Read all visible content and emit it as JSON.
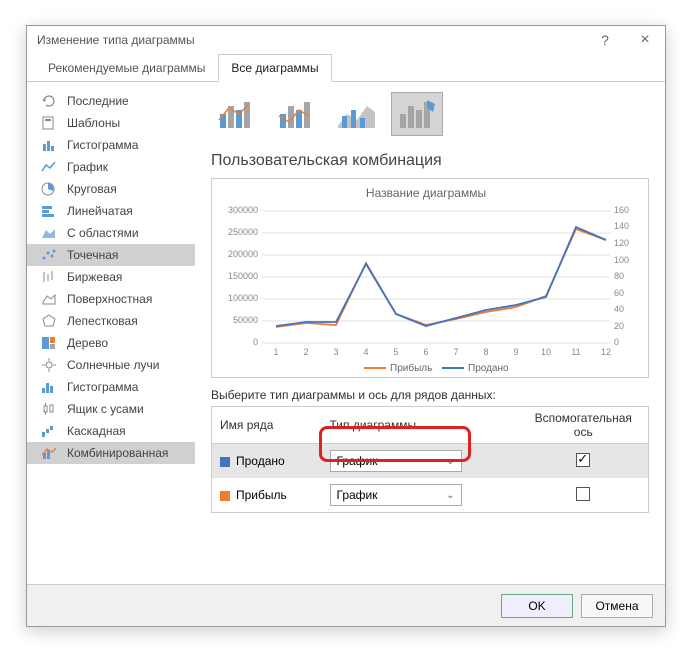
{
  "window": {
    "title": "Изменение типа диаграммы"
  },
  "tabs": {
    "recommended": "Рекомендуемые диаграммы",
    "all": "Все диаграммы"
  },
  "sidebar": {
    "items": [
      {
        "label": "Последние"
      },
      {
        "label": "Шаблоны"
      },
      {
        "label": "Гистограмма"
      },
      {
        "label": "График"
      },
      {
        "label": "Круговая"
      },
      {
        "label": "Линейчатая"
      },
      {
        "label": "С областями"
      },
      {
        "label": "Точечная"
      },
      {
        "label": "Биржевая"
      },
      {
        "label": "Поверхностная"
      },
      {
        "label": "Лепестковая"
      },
      {
        "label": "Дерево"
      },
      {
        "label": "Солнечные лучи"
      },
      {
        "label": "Гистограмма"
      },
      {
        "label": "Ящик с усами"
      },
      {
        "label": "Каскадная"
      },
      {
        "label": "Комбинированная"
      }
    ]
  },
  "section": {
    "title": "Пользовательская комбинация"
  },
  "chart": {
    "title": "Название диаграммы"
  },
  "chart_data": {
    "type": "line",
    "title": "Название диаграммы",
    "x": [
      1,
      2,
      3,
      4,
      5,
      6,
      7,
      8,
      9,
      10,
      11,
      12
    ],
    "series": [
      {
        "name": "Прибыль",
        "axis": "left",
        "color": "#ed7d31",
        "values": [
          35000,
          45000,
          40000,
          180000,
          65000,
          40000,
          55000,
          70000,
          80000,
          105000,
          260000,
          235000
        ]
      },
      {
        "name": "Продано",
        "axis": "right",
        "color": "#4472c4",
        "values": [
          20,
          25,
          25,
          95,
          35,
          20,
          30,
          40,
          45,
          55,
          140,
          125
        ]
      }
    ],
    "left_axis": {
      "min": 0,
      "max": 300000,
      "step": 50000
    },
    "right_axis": {
      "min": 0,
      "max": 160,
      "step": 20
    },
    "legend": [
      "Прибыль",
      "Продано"
    ]
  },
  "instruction": "Выберите тип диаграммы и ось для рядов данных:",
  "table": {
    "headers": {
      "name": "Имя ряда",
      "type": "Тип диаграммы",
      "secondary": "Вспомогательная ось"
    },
    "rows": [
      {
        "name": "Продано",
        "type": "График",
        "secondary": true,
        "color": "#4472c4"
      },
      {
        "name": "Прибыль",
        "type": "График",
        "secondary": false,
        "color": "#ed7d31"
      }
    ]
  },
  "buttons": {
    "ok": "OK",
    "cancel": "Отмена"
  }
}
